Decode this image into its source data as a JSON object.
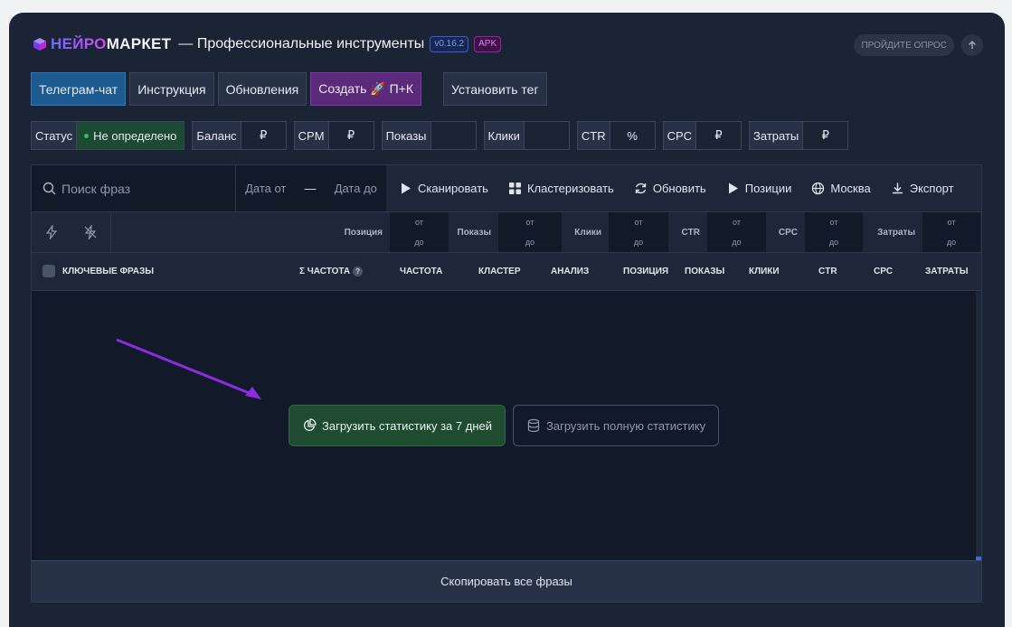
{
  "header": {
    "logo_part1": "НЕЙРО",
    "logo_part2": "МАРКЕТ",
    "subtitle": "— Профессиональные инструменты",
    "version_badge": "v0.16.2",
    "apk_badge": "APK",
    "survey_label": "ПРОЙДИТЕ ОПРОС"
  },
  "nav": {
    "telegram": "Телеграм-чат",
    "instruction": "Инструкция",
    "updates": "Обновления",
    "create": "Создать 🚀 П+К",
    "set_tag": "Установить тег"
  },
  "metrics": {
    "status_label": "Статус",
    "status_value": "Не определено",
    "balance_label": "Баланс",
    "balance_unit": "₽",
    "cpm_label": "CPM",
    "cpm_unit": "₽",
    "shows_label": "Показы",
    "clicks_label": "Клики",
    "ctr_label": "CTR",
    "ctr_unit": "%",
    "cpc_label": "CPC",
    "cpc_unit": "₽",
    "costs_label": "Затраты",
    "costs_unit": "₽"
  },
  "toolbar": {
    "search_placeholder": "Поиск фраз",
    "date_from": "Дата от",
    "date_dash": "—",
    "date_to": "Дата до",
    "scan": "Сканировать",
    "cluster": "Кластеризовать",
    "refresh": "Обновить",
    "positions": "Позиции",
    "region": "Москва",
    "export": "Экспорт"
  },
  "filters": {
    "from": "от",
    "to": "до",
    "position": "Позиция",
    "shows": "Показы",
    "clicks": "Клики",
    "ctr": "CTR",
    "cpc": "CPC",
    "costs": "Затраты"
  },
  "table": {
    "headers": {
      "phrases": "КЛЮЧЕВЫЕ ФРАЗЫ",
      "sum_freq": "Σ ЧАСТОТА",
      "freq": "ЧАСТОТА",
      "cluster": "КЛАСТЕР",
      "analysis": "АНАЛИЗ",
      "position": "ПОЗИЦИЯ",
      "shows": "ПОКАЗЫ",
      "clicks": "КЛИКИ",
      "ctr": "CTR",
      "cpc": "CPC",
      "costs": "ЗАТРАТЫ"
    },
    "help_mark": "?"
  },
  "actions": {
    "load_7_days": "Загрузить статистику за 7 дней",
    "load_full": "Загрузить полную статистику",
    "copy_all": "Скопировать все фразы"
  },
  "colors": {
    "accent_blue": "#1d5a8f",
    "accent_purple": "#5b2a7a",
    "success_green": "#1f4b30",
    "arrow": "#8b2be2"
  }
}
